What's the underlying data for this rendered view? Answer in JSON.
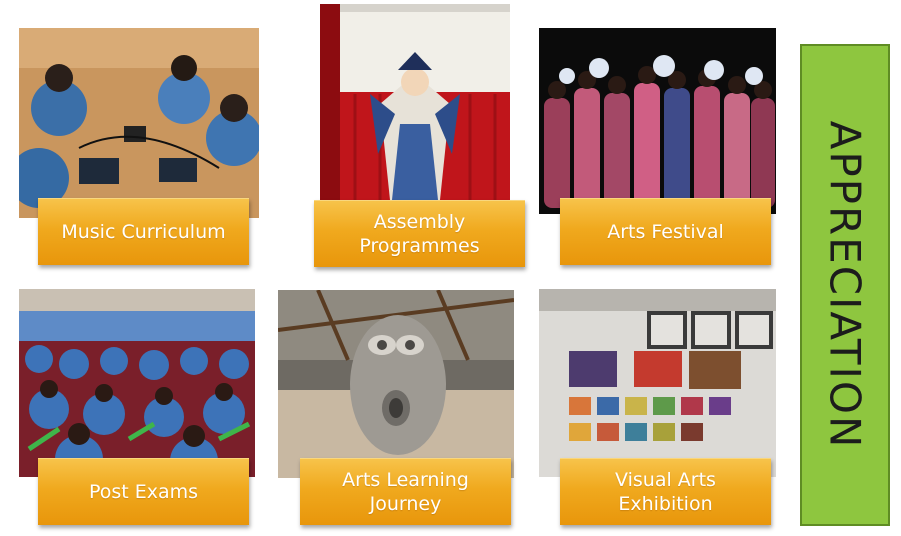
{
  "tiles": [
    {
      "label": "Music Curriculum",
      "photo": "students-with-tablets-photo"
    },
    {
      "label": "Assembly\nProgrammes",
      "photo": "opera-performer-on-stage-photo"
    },
    {
      "label": "Arts Festival",
      "photo": "dancers-with-fans-photo"
    },
    {
      "label": "Post Exams",
      "photo": "students-in-auditorium-photo"
    },
    {
      "label": "Arts Learning\nJourney",
      "photo": "clay-sculpture-photo"
    },
    {
      "label": "Visual Arts\nExhibition",
      "photo": "artwork-wall-display-photo"
    }
  ],
  "side_banner": {
    "text": "APPRECIATION",
    "color": "#8ec63f"
  },
  "colors": {
    "label_gold": "#f0a91e",
    "banner_green": "#8ec63f"
  }
}
